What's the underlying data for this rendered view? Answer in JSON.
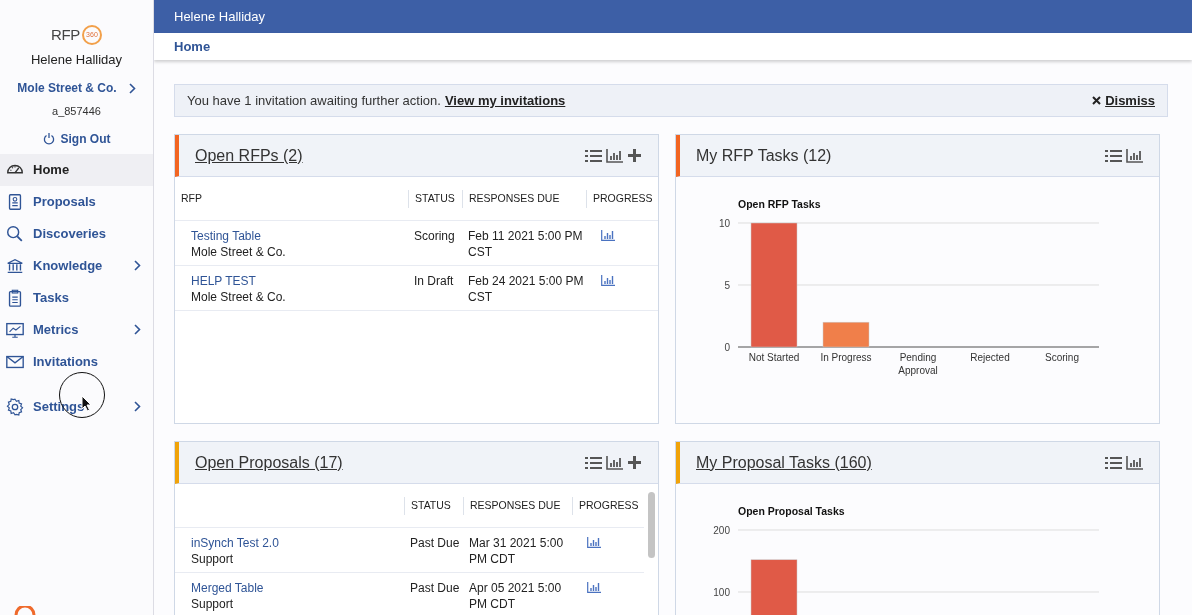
{
  "sidebar": {
    "logo": {
      "text": "RFP",
      "badge": "360"
    },
    "user_name": "Helene Halliday",
    "company": "Mole Street & Co.",
    "account_id": "a_857446",
    "sign_out": "Sign Out",
    "nav_groups": [
      {
        "items": [
          {
            "label": "Home",
            "selected": true,
            "has_submenu": false
          },
          {
            "label": "Proposals",
            "selected": false,
            "has_submenu": false
          },
          {
            "label": "Discoveries",
            "selected": false,
            "has_submenu": false
          },
          {
            "label": "Knowledge",
            "selected": false,
            "has_submenu": true
          },
          {
            "label": "Tasks",
            "selected": false,
            "has_submenu": false
          },
          {
            "label": "Metrics",
            "selected": false,
            "has_submenu": true
          },
          {
            "label": "Invitations",
            "selected": false,
            "has_submenu": false
          }
        ]
      },
      {
        "items": [
          {
            "label": "Settings",
            "selected": false,
            "has_submenu": true
          }
        ]
      }
    ]
  },
  "top_bar": {
    "user_name": "Helene Halliday"
  },
  "breadcrumb": "Home",
  "notice": {
    "text": "You have 1 invitation awaiting further action.",
    "link": "View my invitations",
    "dismiss": "Dismiss"
  },
  "panels": [
    {
      "kind": "table",
      "title": "Open RFPs (2)",
      "linked": true,
      "columns": [
        "RFP",
        "STATUS",
        "RESPONSES DUE",
        "PROGRESS"
      ],
      "scrollbar": false,
      "rows": [
        {
          "title": "Testing Table",
          "subtitle": "Mole Street & Co.",
          "status": "Scoring",
          "due": "Feb 11 2021 5:00 PM CST"
        },
        {
          "title": "HELP TEST",
          "subtitle": "Mole Street & Co.",
          "status": "In Draft",
          "due": "Feb 24 2021 5:00 PM CST"
        }
      ]
    },
    {
      "kind": "chart",
      "title": "My RFP Tasks (12)",
      "linked": false,
      "chart_data": {
        "type": "bar",
        "title": "Open RFP Tasks",
        "categories": [
          "Not Started",
          "In Progress",
          "Pending Approval",
          "Rejected",
          "Scoring"
        ],
        "series": [
          {
            "color": "#e05a47",
            "values": [
              10,
              0,
              0,
              0,
              0
            ]
          },
          {
            "color": "#f07f4a",
            "values": [
              0,
              2,
              0,
              0,
              0
            ]
          }
        ],
        "ylim": [
          0,
          10
        ],
        "yticks": [
          0,
          5,
          10
        ]
      }
    },
    {
      "kind": "table",
      "title": "Open Proposals (17)",
      "linked": true,
      "columns": [
        "STATUS",
        "RESPONSES DUE",
        "PROGRESS"
      ],
      "scrollbar": true,
      "rows": [
        {
          "title": "inSynch Test 2.0",
          "subtitle": "Support",
          "status": "Past Due",
          "due": "Mar 31 2021 5:00 PM CDT"
        },
        {
          "title": "Merged Table",
          "subtitle": "Support",
          "status": "Past Due",
          "due": "Apr 05 2021 5:00 PM CDT"
        }
      ]
    },
    {
      "kind": "chart",
      "title": "My Proposal Tasks (160)",
      "linked": true,
      "chart_data": {
        "type": "bar",
        "title": "Open Proposal Tasks",
        "series": [
          {
            "color": "#e05a47",
            "values": [
              152
            ]
          }
        ],
        "ylim": [
          0,
          200
        ],
        "yticks": [
          100,
          200
        ]
      }
    }
  ]
}
